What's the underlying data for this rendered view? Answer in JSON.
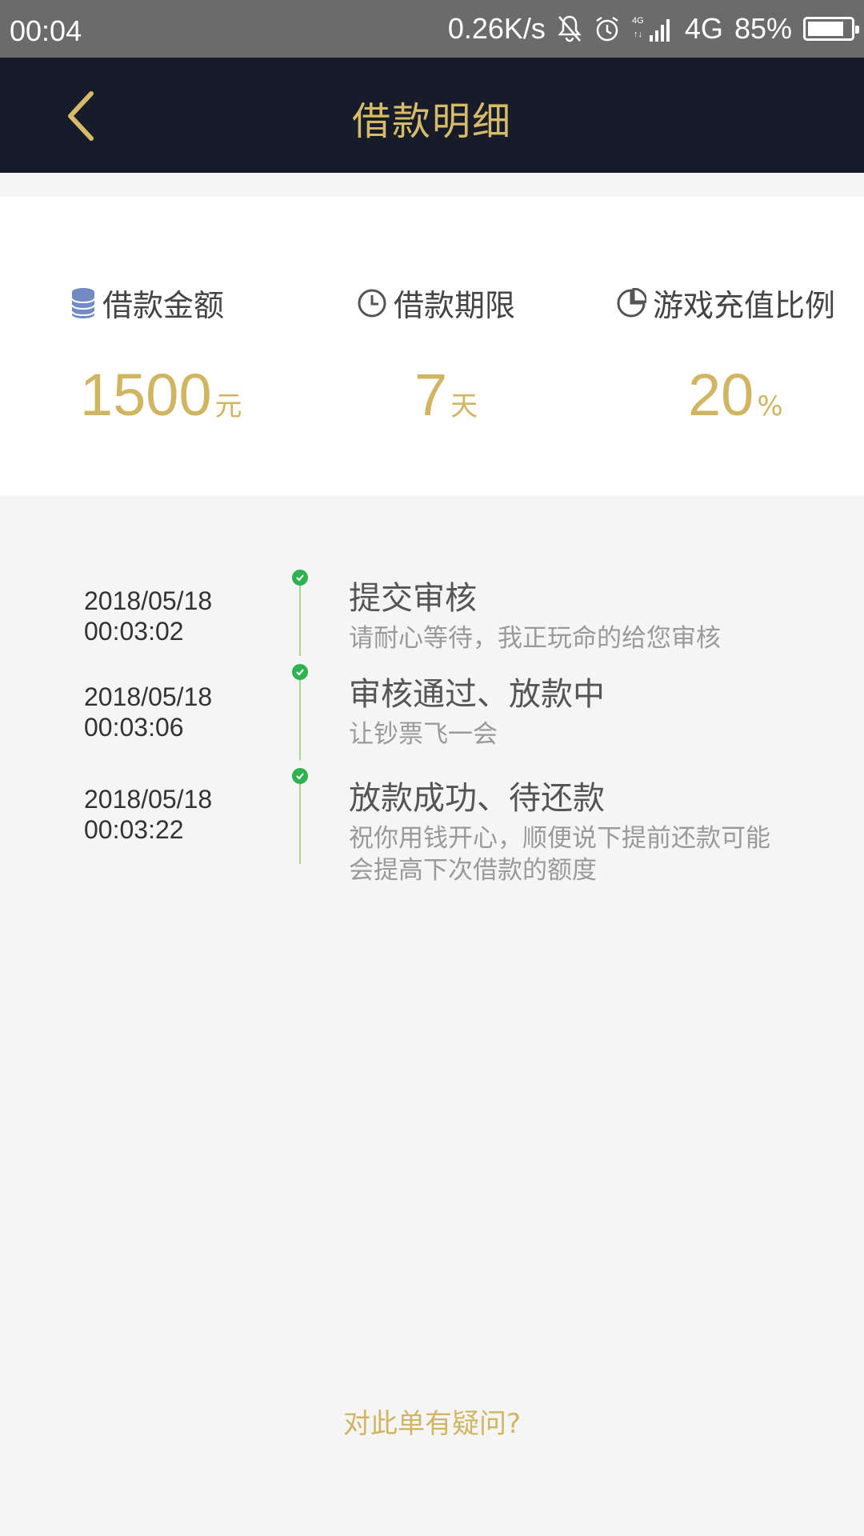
{
  "status_bar": {
    "time": "00:04",
    "speed": "0.26K/s",
    "network": "4G",
    "battery": "85%",
    "battery_level": 0.85
  },
  "nav": {
    "title": "借款明细",
    "back_icon": "chevron-left-icon"
  },
  "summary": {
    "amount": {
      "icon": "coin-stack-icon",
      "label": "借款金额",
      "value": "1500",
      "unit": "元"
    },
    "term": {
      "icon": "clock-icon",
      "label": "借款期限",
      "value": "7",
      "unit": "天"
    },
    "ratio": {
      "icon": "pie-chart-icon",
      "label": "游戏充值比例",
      "value": "20",
      "unit": "%"
    }
  },
  "timeline": [
    {
      "date": "2018/05/18",
      "time": "00:03:02",
      "title": "提交审核",
      "desc": "请耐心等待，我正玩命的给您审核"
    },
    {
      "date": "2018/05/18",
      "time": "00:03:06",
      "title": "审核通过、放款中",
      "desc": "让钞票飞一会"
    },
    {
      "date": "2018/05/18",
      "time": "00:03:22",
      "title": "放款成功、待还款",
      "desc": "祝你用钱开心，顺便说下提前还款可能会提高下次借款的额度"
    }
  ],
  "footer": {
    "question_link": "对此单有疑问?"
  },
  "colors": {
    "gold": "#d0b563",
    "nav_bg": "#171c2a",
    "status_bg": "#6b6b6b",
    "success_green": "#2fb350"
  }
}
